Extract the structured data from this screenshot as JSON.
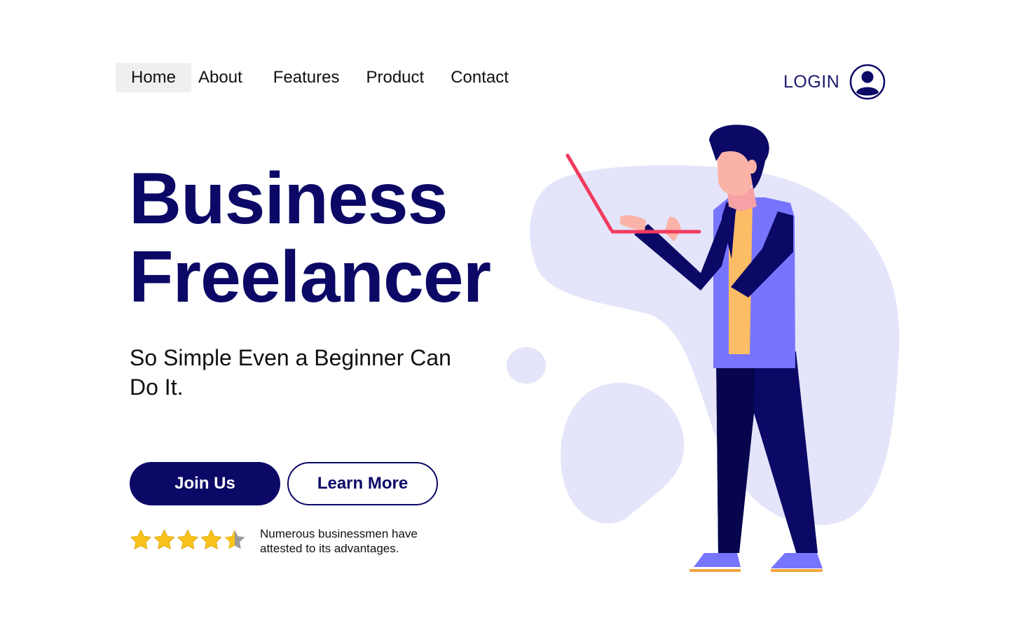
{
  "nav": {
    "items": [
      {
        "label": "Home",
        "active": true
      },
      {
        "label": "About"
      },
      {
        "label": "Features"
      },
      {
        "label": "Product"
      },
      {
        "label": "Contact"
      }
    ]
  },
  "login": {
    "label": "LOGIN",
    "icon": "user-circle-icon"
  },
  "hero": {
    "title_line1": "Business",
    "title_line2": "Freelancer",
    "subtitle": "So Simple Even a Beginner Can Do It.",
    "primary_button": "Join Us",
    "secondary_button": "Learn More"
  },
  "rating": {
    "value": 4.5,
    "max": 5,
    "text": "Numerous businessmen have attested to its advantages."
  },
  "colors": {
    "primary": "#0b0866",
    "blob": "#e4e4fa",
    "star": "#f9c31b",
    "accent": "#f23a5e",
    "jacket": "#7775fe"
  }
}
